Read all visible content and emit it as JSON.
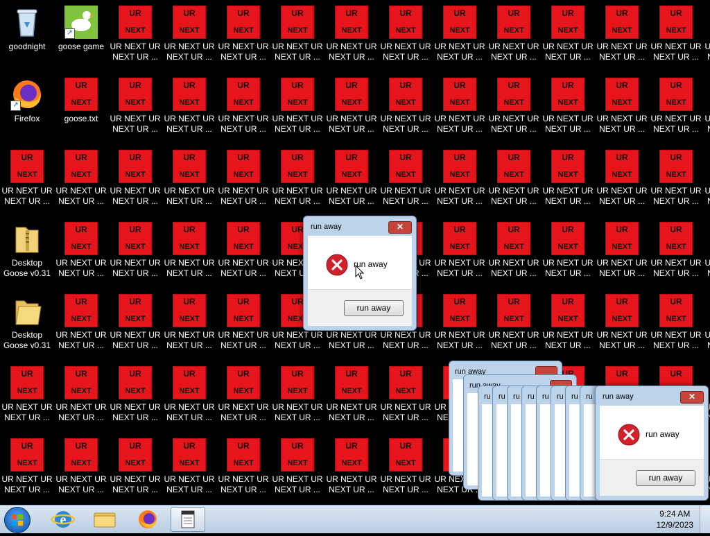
{
  "desktop": {
    "fixed_icons": [
      {
        "label": "goodnight",
        "type": "bin"
      },
      {
        "label": "goose game",
        "type": "goose"
      },
      {
        "label": "Firefox",
        "type": "firefox"
      },
      {
        "label": "goose.txt",
        "type": "ur"
      },
      {
        "label": "Desktop Goose v0.31",
        "type": "zip"
      },
      {
        "label": "Desktop Goose v0.31",
        "type": "folder"
      }
    ],
    "ur_icon": {
      "top_text": "UR",
      "bottom_text": "NEXT",
      "label": "UR NEXT UR NEXT UR ..."
    }
  },
  "dialogs": {
    "main": {
      "title": "run away",
      "message": "run away",
      "button": "run away",
      "close": "✕"
    },
    "front": {
      "title": "run away",
      "message": "run away",
      "button": "run away",
      "close": "✕"
    },
    "ghost_title": "run away",
    "ghost_fragment": "ru"
  },
  "taskbar": {
    "time": "9:24 AM",
    "date": "12/9/2023",
    "pinned": [
      "internet-explorer-icon",
      "file-explorer-icon",
      "firefox-icon",
      "notepad-icon"
    ]
  },
  "colors": {
    "ur_red": "#e8141b",
    "dialog_frame": "#bcd3ea",
    "close_red": "#c7443a",
    "error_red": "#d3202a"
  }
}
